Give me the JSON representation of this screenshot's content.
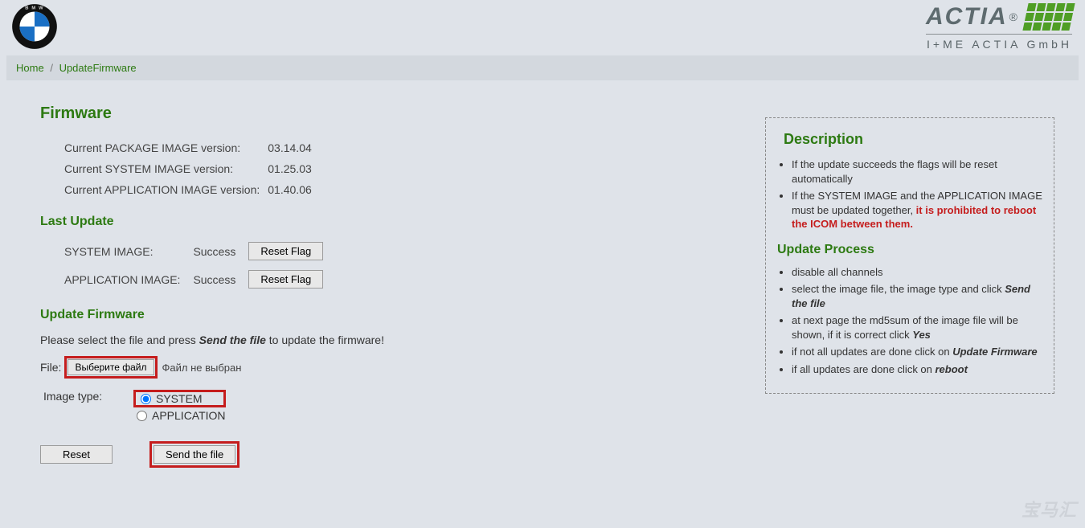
{
  "logos": {
    "bmw": "BMW",
    "actia": "ACTIA",
    "actia_sub": "I+ME ACTIA GmbH"
  },
  "breadcrumb": {
    "home": "Home",
    "sep": "/",
    "current": "UpdateFirmware"
  },
  "firmware": {
    "title": "Firmware",
    "rows": [
      {
        "label": "Current PACKAGE IMAGE version:",
        "value": "03.14.04"
      },
      {
        "label": "Current SYSTEM IMAGE version:",
        "value": "01.25.03"
      },
      {
        "label": "Current APPLICATION IMAGE version:",
        "value": "01.40.06"
      }
    ]
  },
  "last_update": {
    "title": "Last Update",
    "rows": [
      {
        "label": "SYSTEM IMAGE:",
        "status": "Success",
        "btn": "Reset Flag"
      },
      {
        "label": "APPLICATION IMAGE:",
        "status": "Success",
        "btn": "Reset Flag"
      }
    ]
  },
  "update_fw": {
    "title": "Update Firmware",
    "instr_pre": "Please select the file and press ",
    "instr_em": "Send the file",
    "instr_post": " to update the firmware!",
    "file_label": "File:",
    "file_button": "Выберите файл",
    "file_status": "Файл не выбран",
    "imgtype_label": "Image type:",
    "radio_system": "SYSTEM",
    "radio_application": "APPLICATION",
    "reset_btn": "Reset",
    "send_btn": "Send the file"
  },
  "description": {
    "title": "Description",
    "bullets": {
      "b1": "If the update succeeds the flags will be reset automatically",
      "b2_pre": "If the SYSTEM IMAGE and the APPLICATION IMAGE must be updated together, ",
      "b2_red": "it is prohibited to reboot the ICOM between them."
    },
    "process_title": "Update Process",
    "process": {
      "p1": "disable all channels",
      "p2_pre": "select the image file, the image type and click ",
      "p2_em": "Send the file",
      "p3_pre": "at next page the md5sum of the image file will be shown, if it is correct click ",
      "p3_em": "Yes",
      "p4_pre": "if not all updates are done click on ",
      "p4_em": "Update Firmware",
      "p5_pre": "if all updates are done click on ",
      "p5_em": "reboot"
    }
  },
  "watermark": "宝马汇"
}
